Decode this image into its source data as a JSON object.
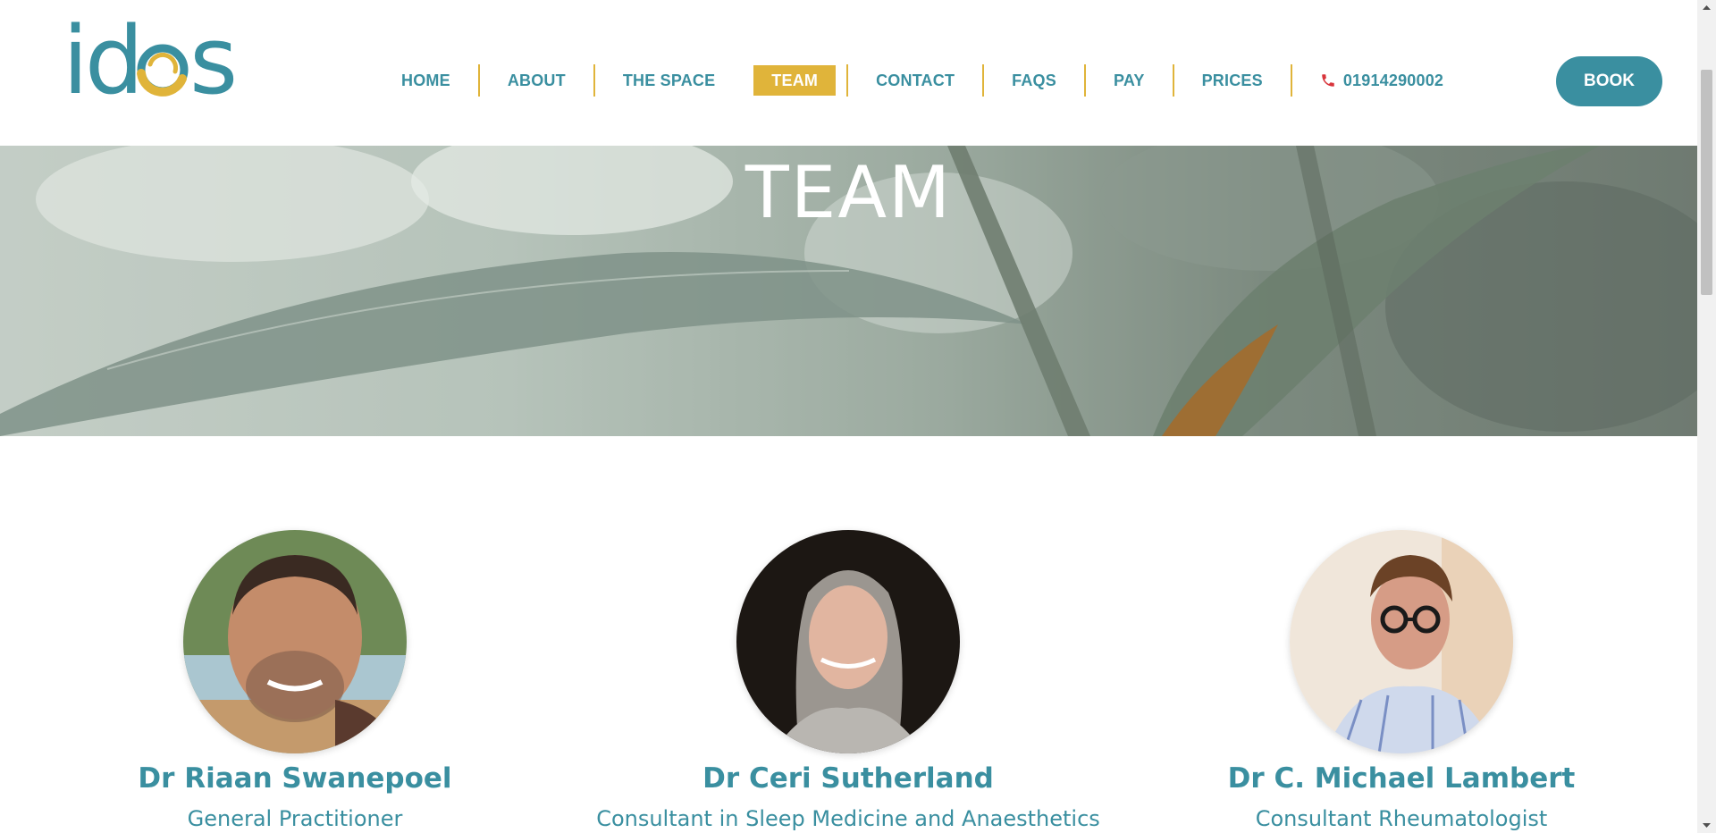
{
  "header": {
    "logo_text": "idos",
    "nav": [
      {
        "label": "HOME",
        "active": false
      },
      {
        "label": "ABOUT",
        "active": false
      },
      {
        "label": "THE SPACE",
        "active": false
      },
      {
        "label": "TEAM",
        "active": true
      },
      {
        "label": "CONTACT",
        "active": false
      },
      {
        "label": "FAQS",
        "active": false
      },
      {
        "label": "PAY",
        "active": false
      },
      {
        "label": "PRICES",
        "active": false
      }
    ],
    "phone": "01914290002",
    "phone_icon": "phone-icon",
    "book_label": "BOOK"
  },
  "hero": {
    "title": "TEAM"
  },
  "team": {
    "members": [
      {
        "name": "Dr Riaan Swanepoel",
        "role": "General Practitioner"
      },
      {
        "name": "Dr Ceri Sutherland",
        "role": "Consultant in Sleep Medicine and Anaesthetics"
      },
      {
        "name": "Dr C. Michael Lambert",
        "role": "Consultant Rheumatologist"
      }
    ]
  },
  "colors": {
    "brand_teal": "#3a8fa0",
    "accent_gold": "#e0b43a",
    "phone_red": "#d8343b"
  }
}
